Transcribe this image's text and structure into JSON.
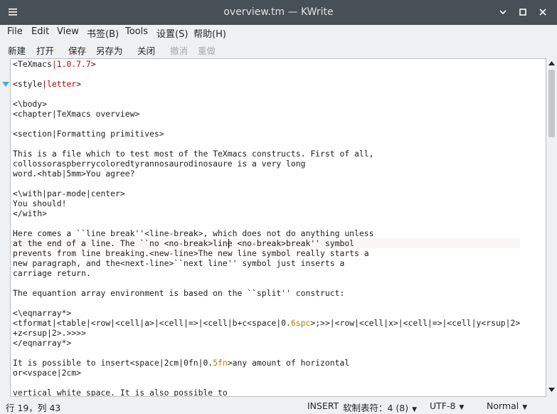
{
  "window": {
    "title": "overview.tm — KWrite",
    "controls": [
      "minimize",
      "maximize",
      "close"
    ]
  },
  "menu": [
    "File",
    "Edit",
    "View",
    "书签(B)",
    "Tools",
    "设置(S)",
    "帮助(H)"
  ],
  "toolbar": {
    "new": "新建",
    "open": "打开",
    "save": "保存",
    "save_as": "另存为",
    "close": "关闭",
    "undo": "撤消",
    "redo": "重做"
  },
  "editor": {
    "lines": [
      [
        {
          "t": "<TeXmacs"
        },
        {
          "t": "|1.0.7.7",
          "c": "str"
        },
        {
          "t": ">"
        }
      ],
      [],
      [
        {
          "t": "<style"
        },
        {
          "t": "|letter",
          "c": "str"
        },
        {
          "t": ">"
        }
      ],
      [],
      [
        {
          "t": "<\\body>"
        }
      ],
      [
        {
          "t": "<chapter|TeXmacs overview>"
        }
      ],
      [],
      [
        {
          "t": "<section|Formatting primitives>"
        }
      ],
      [],
      [
        {
          "t": "This is a file which to test most of the TeXmacs constructs. First of all,"
        }
      ],
      [
        {
          "t": "collossoraspberrycoloredtyrannosaurodinosaure is a very long"
        }
      ],
      [
        {
          "t": "word.<htab|5mm>You agree?"
        }
      ],
      [],
      [
        {
          "t": "<\\with|par-mode|center>"
        }
      ],
      [
        {
          "t": "You should!"
        }
      ],
      [
        {
          "t": "</with>"
        }
      ],
      [],
      [
        {
          "t": "Here comes a ``line break''<line-break>, which does not do anything unless"
        }
      ],
      [
        {
          "t": "at the end of a line. The ``no <no-break>line <no-break>break'' symbol"
        }
      ],
      [
        {
          "t": "prevents from line breaking.<new-line>The new line symbol really starts a"
        }
      ],
      [
        {
          "t": "new paragraph, and the<next-line>``next line'' symbol just inserts a"
        }
      ],
      [
        {
          "t": "carriage return."
        }
      ],
      [],
      [
        {
          "t": "The equantion array environment is based on the ``split'' construct:"
        }
      ],
      [],
      [
        {
          "t": "<\\eqnarray*>"
        }
      ],
      [
        {
          "t": "<tformat|<table|<row|<cell|a>|<cell|=>|<cell|b+c<space|0."
        },
        {
          "t": "6spc",
          "c": "num"
        },
        {
          "t": ">;>>|<row|<cell|x>|<cell|=>|<cell|y<rsup|2>"
        }
      ],
      [
        {
          "t": "+z<rsup|2>.>>>>"
        }
      ],
      [
        {
          "t": "</eqnarray*>"
        }
      ],
      [],
      [
        {
          "t": "It is possible to insert<space|2cm|0fn|0."
        },
        {
          "t": "5fn",
          "c": "num"
        },
        {
          "t": ">any amount of horizontal"
        }
      ],
      [
        {
          "t": "or<vspace|2cm>"
        }
      ],
      [],
      [
        {
          "t": "vertical white space. It is also possible to"
        }
      ]
    ]
  },
  "status": {
    "position": "行 19，列 43",
    "mode": "INSERT",
    "tabs": "软制表符：4 (8)",
    "encoding": "UTF-8",
    "syntax": "Normal"
  }
}
